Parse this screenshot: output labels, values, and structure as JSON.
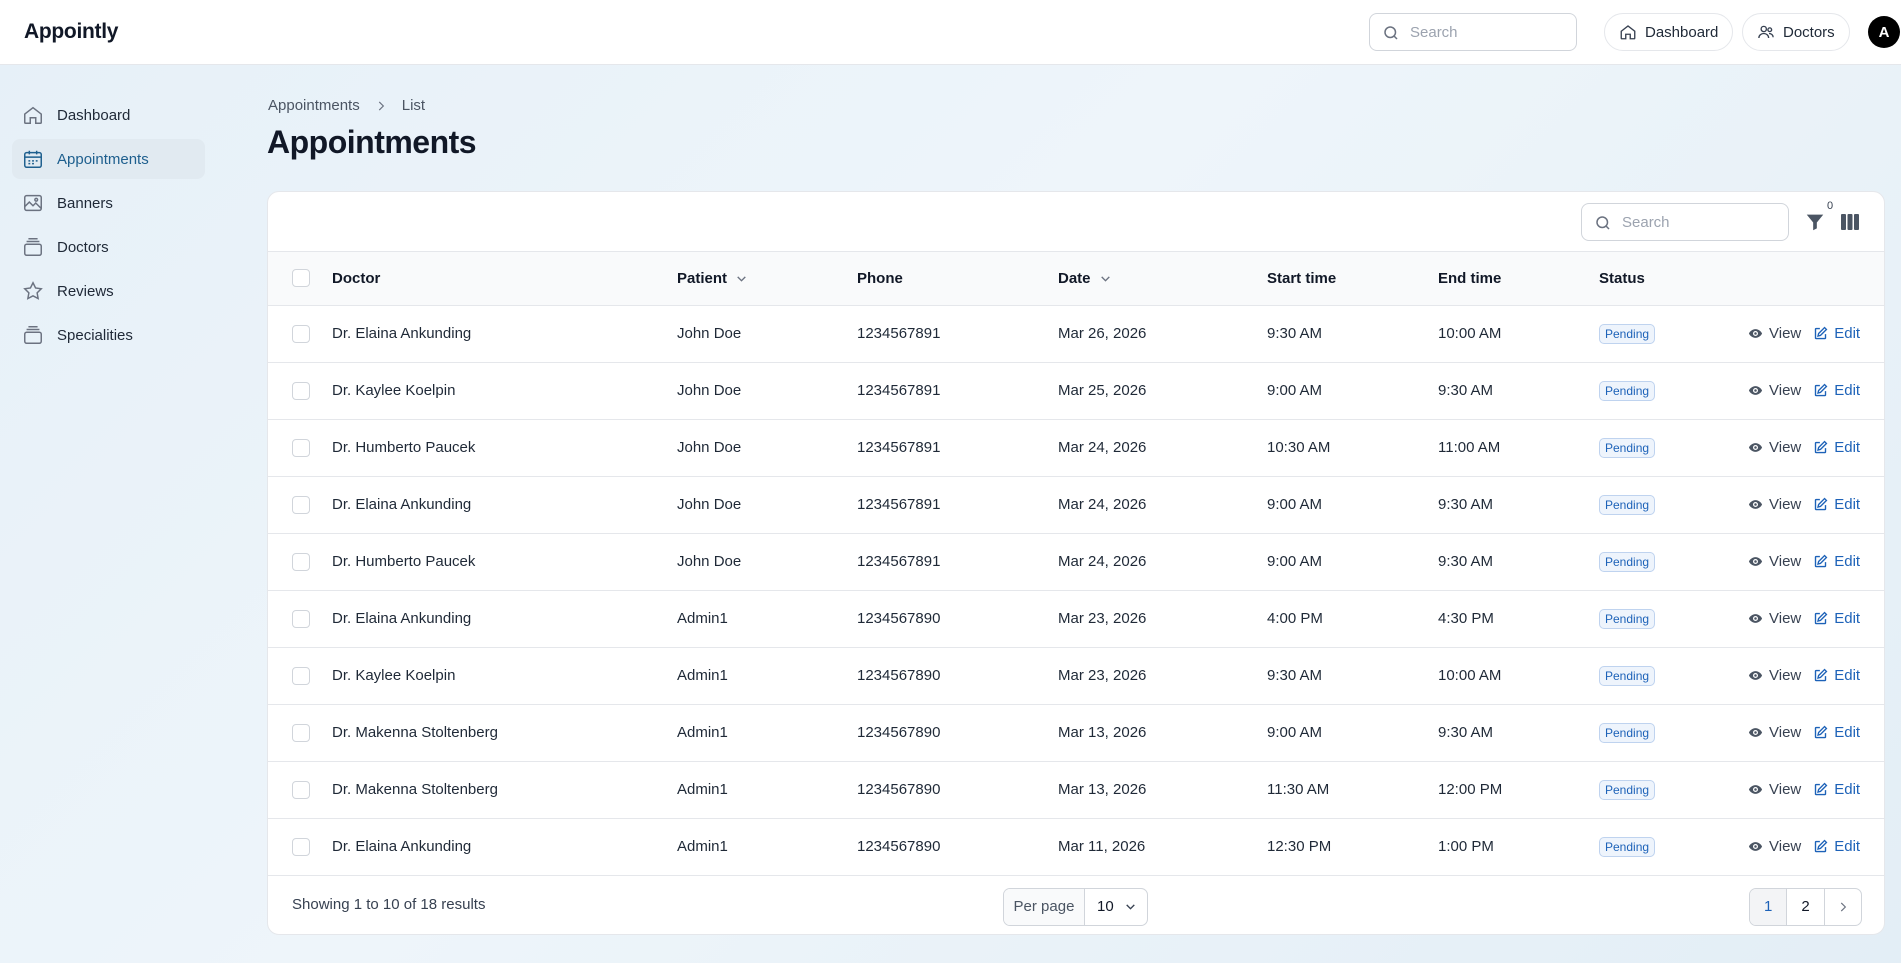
{
  "app": {
    "brand": "Appointly",
    "avatar_initial": "A"
  },
  "topbar": {
    "search_placeholder": "Search",
    "nav": [
      {
        "label": "Dashboard",
        "icon": "home-icon"
      },
      {
        "label": "Doctors",
        "icon": "users-icon"
      }
    ]
  },
  "sidebar": {
    "items": [
      {
        "label": "Dashboard",
        "icon": "home-icon",
        "active": false
      },
      {
        "label": "Appointments",
        "icon": "calendar-icon",
        "active": true
      },
      {
        "label": "Banners",
        "icon": "image-icon",
        "active": false
      },
      {
        "label": "Doctors",
        "icon": "stack-icon",
        "active": false
      },
      {
        "label": "Reviews",
        "icon": "star-icon",
        "active": false
      },
      {
        "label": "Specialities",
        "icon": "stack-icon",
        "active": false
      }
    ]
  },
  "breadcrumb": {
    "parent": "Appointments",
    "current": "List"
  },
  "page": {
    "title": "Appointments"
  },
  "table": {
    "search_placeholder": "Search",
    "filter_count": "0",
    "columns": {
      "doctor": "Doctor",
      "patient": "Patient",
      "phone": "Phone",
      "date": "Date",
      "start": "Start time",
      "end": "End time",
      "status": "Status"
    },
    "actions": {
      "view": "View",
      "edit": "Edit"
    },
    "rows": [
      {
        "doctor": "Dr. Elaina Ankunding",
        "patient": "John Doe",
        "phone": "1234567891",
        "date": "Mar 26, 2026",
        "start": "9:30 AM",
        "end": "10:00 AM",
        "status": "Pending"
      },
      {
        "doctor": "Dr. Kaylee Koelpin",
        "patient": "John Doe",
        "phone": "1234567891",
        "date": "Mar 25, 2026",
        "start": "9:00 AM",
        "end": "9:30 AM",
        "status": "Pending"
      },
      {
        "doctor": "Dr. Humberto Paucek",
        "patient": "John Doe",
        "phone": "1234567891",
        "date": "Mar 24, 2026",
        "start": "10:30 AM",
        "end": "11:00 AM",
        "status": "Pending"
      },
      {
        "doctor": "Dr. Elaina Ankunding",
        "patient": "John Doe",
        "phone": "1234567891",
        "date": "Mar 24, 2026",
        "start": "9:00 AM",
        "end": "9:30 AM",
        "status": "Pending"
      },
      {
        "doctor": "Dr. Humberto Paucek",
        "patient": "John Doe",
        "phone": "1234567891",
        "date": "Mar 24, 2026",
        "start": "9:00 AM",
        "end": "9:30 AM",
        "status": "Pending"
      },
      {
        "doctor": "Dr. Elaina Ankunding",
        "patient": "Admin1",
        "phone": "1234567890",
        "date": "Mar 23, 2026",
        "start": "4:00 PM",
        "end": "4:30 PM",
        "status": "Pending"
      },
      {
        "doctor": "Dr. Kaylee Koelpin",
        "patient": "Admin1",
        "phone": "1234567890",
        "date": "Mar 23, 2026",
        "start": "9:30 AM",
        "end": "10:00 AM",
        "status": "Pending"
      },
      {
        "doctor": "Dr. Makenna Stoltenberg",
        "patient": "Admin1",
        "phone": "1234567890",
        "date": "Mar 13, 2026",
        "start": "9:00 AM",
        "end": "9:30 AM",
        "status": "Pending"
      },
      {
        "doctor": "Dr. Makenna Stoltenberg",
        "patient": "Admin1",
        "phone": "1234567890",
        "date": "Mar 13, 2026",
        "start": "11:30 AM",
        "end": "12:00 PM",
        "status": "Pending"
      },
      {
        "doctor": "Dr. Elaina Ankunding",
        "patient": "Admin1",
        "phone": "1234567890",
        "date": "Mar 11, 2026",
        "start": "12:30 PM",
        "end": "1:00 PM",
        "status": "Pending"
      }
    ]
  },
  "footer": {
    "showing": "Showing 1 to 10 of 18 results",
    "per_page_label": "Per page",
    "per_page_value": "10",
    "pages": [
      "1",
      "2"
    ]
  },
  "colors": {
    "accent": "#1d62b8",
    "active_bg": "#e1eaf1",
    "active_text": "#1e5f8e"
  }
}
